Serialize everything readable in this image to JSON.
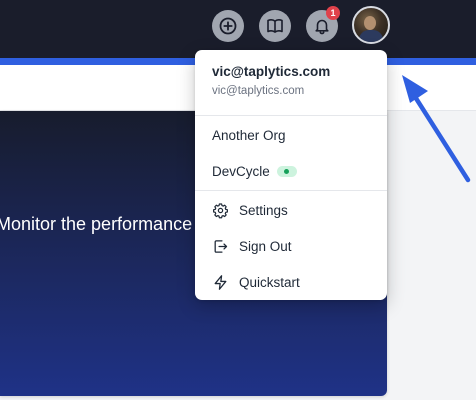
{
  "topbar": {
    "icons": [
      {
        "name": "add-circle-icon"
      },
      {
        "name": "book-icon"
      },
      {
        "name": "bell-icon",
        "badge": "1"
      }
    ],
    "avatar": {
      "name": "avatar"
    }
  },
  "hero": {
    "text": "Monitor the performance of feature"
  },
  "dropdown": {
    "user_name": "vic@taplytics.com",
    "user_email": "vic@taplytics.com",
    "orgs": [
      {
        "label": "Another Org",
        "active": false
      },
      {
        "label": "DevCycle",
        "active": true
      }
    ],
    "actions": [
      {
        "label": "Settings",
        "icon": "gear-icon"
      },
      {
        "label": "Sign Out",
        "icon": "sign-out-icon"
      },
      {
        "label": "Quickstart",
        "icon": "lightning-icon"
      }
    ]
  },
  "colors": {
    "topbar_bg": "#1a1d2b",
    "accent": "#2f5fe0",
    "badge": "#e0424b",
    "active_dot": "#16a05a",
    "annotation_arrow": "#2f5fe0"
  }
}
